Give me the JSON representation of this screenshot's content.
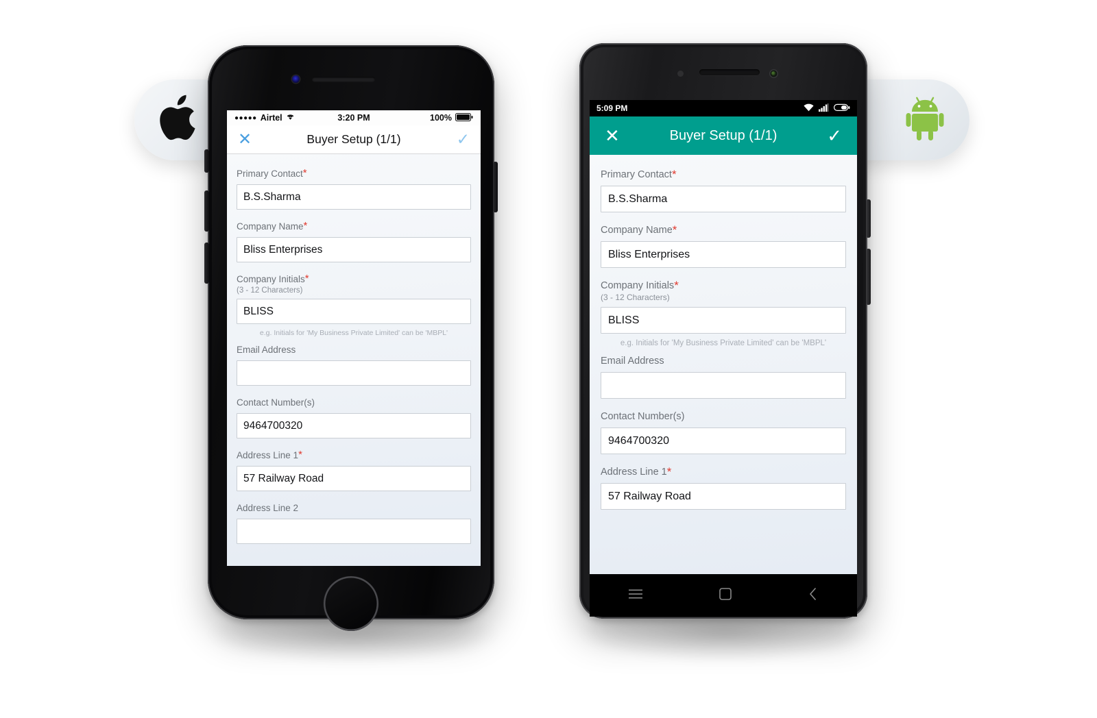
{
  "badges": {
    "apple": {
      "icon": "apple-logo-icon",
      "color": "#111111"
    },
    "android": {
      "icon": "android-robot-icon",
      "color": "#8CC247"
    }
  },
  "ios": {
    "status_bar": {
      "signal_dots": "●●●●●",
      "carrier": "Airtel",
      "wifi_icon": "wifi-icon",
      "time": "3:20 PM",
      "battery_percent": "100%",
      "battery_icon": "battery-full-icon"
    },
    "nav_bar": {
      "close_icon": "close-icon",
      "close_glyph": "✕",
      "title": "Buyer Setup (1/1)",
      "confirm_icon": "check-icon",
      "confirm_glyph": "✓",
      "close_color": "#4A9FE0",
      "confirm_color": "#8EC6EE"
    },
    "form": {
      "fields": [
        {
          "label": "Primary Contact",
          "required": true,
          "sublabel": "",
          "value": "B.S.Sharma",
          "hint": ""
        },
        {
          "label": "Company Name",
          "required": true,
          "sublabel": "",
          "value": "Bliss Enterprises",
          "hint": ""
        },
        {
          "label": "Company Initials",
          "required": true,
          "sublabel": "(3 - 12 Characters)",
          "value": "BLISS",
          "hint": "e.g. Initials for 'My Business Private Limited' can be 'MBPL'"
        },
        {
          "label": "Email Address",
          "required": false,
          "sublabel": "",
          "value": "",
          "hint": ""
        },
        {
          "label": "Contact Number(s)",
          "required": false,
          "sublabel": "",
          "value": "9464700320",
          "hint": ""
        },
        {
          "label": "Address Line 1",
          "required": true,
          "sublabel": "",
          "value": "57 Railway Road",
          "hint": ""
        },
        {
          "label": "Address Line 2",
          "required": false,
          "sublabel": "",
          "value": "",
          "hint": ""
        }
      ]
    },
    "hardware": {
      "home_button": "home-button",
      "speaker": "earpiece-speaker",
      "camera": "front-camera"
    }
  },
  "android": {
    "status_bar": {
      "time": "5:09 PM",
      "wifi_icon": "wifi-icon",
      "signal_icon": "cellular-signal-icon",
      "battery_icon": "battery-icon"
    },
    "app_bar": {
      "close_icon": "close-icon",
      "close_glyph": "✕",
      "title": "Buyer Setup (1/1)",
      "confirm_icon": "check-icon",
      "confirm_glyph": "✓",
      "background_color": "#009E8E"
    },
    "form": {
      "fields": [
        {
          "label": "Primary Contact",
          "required": true,
          "sublabel": "",
          "value": "B.S.Sharma",
          "hint": ""
        },
        {
          "label": "Company Name",
          "required": true,
          "sublabel": "",
          "value": "Bliss Enterprises",
          "hint": ""
        },
        {
          "label": "Company Initials",
          "required": true,
          "sublabel": "(3 - 12 Characters)",
          "value": "BLISS",
          "hint": "e.g. Initials for 'My Business Private Limited' can be 'MBPL'"
        },
        {
          "label": "Email Address",
          "required": false,
          "sublabel": "",
          "value": "",
          "hint": ""
        },
        {
          "label": "Contact Number(s)",
          "required": false,
          "sublabel": "",
          "value": "9464700320",
          "hint": ""
        },
        {
          "label": "Address Line 1",
          "required": true,
          "sublabel": "",
          "value": "57 Railway Road",
          "hint": ""
        }
      ]
    },
    "nav_bar": {
      "menu_icon": "menu-icon",
      "home_icon": "home-square-icon",
      "back_icon": "back-chevron-icon"
    }
  }
}
